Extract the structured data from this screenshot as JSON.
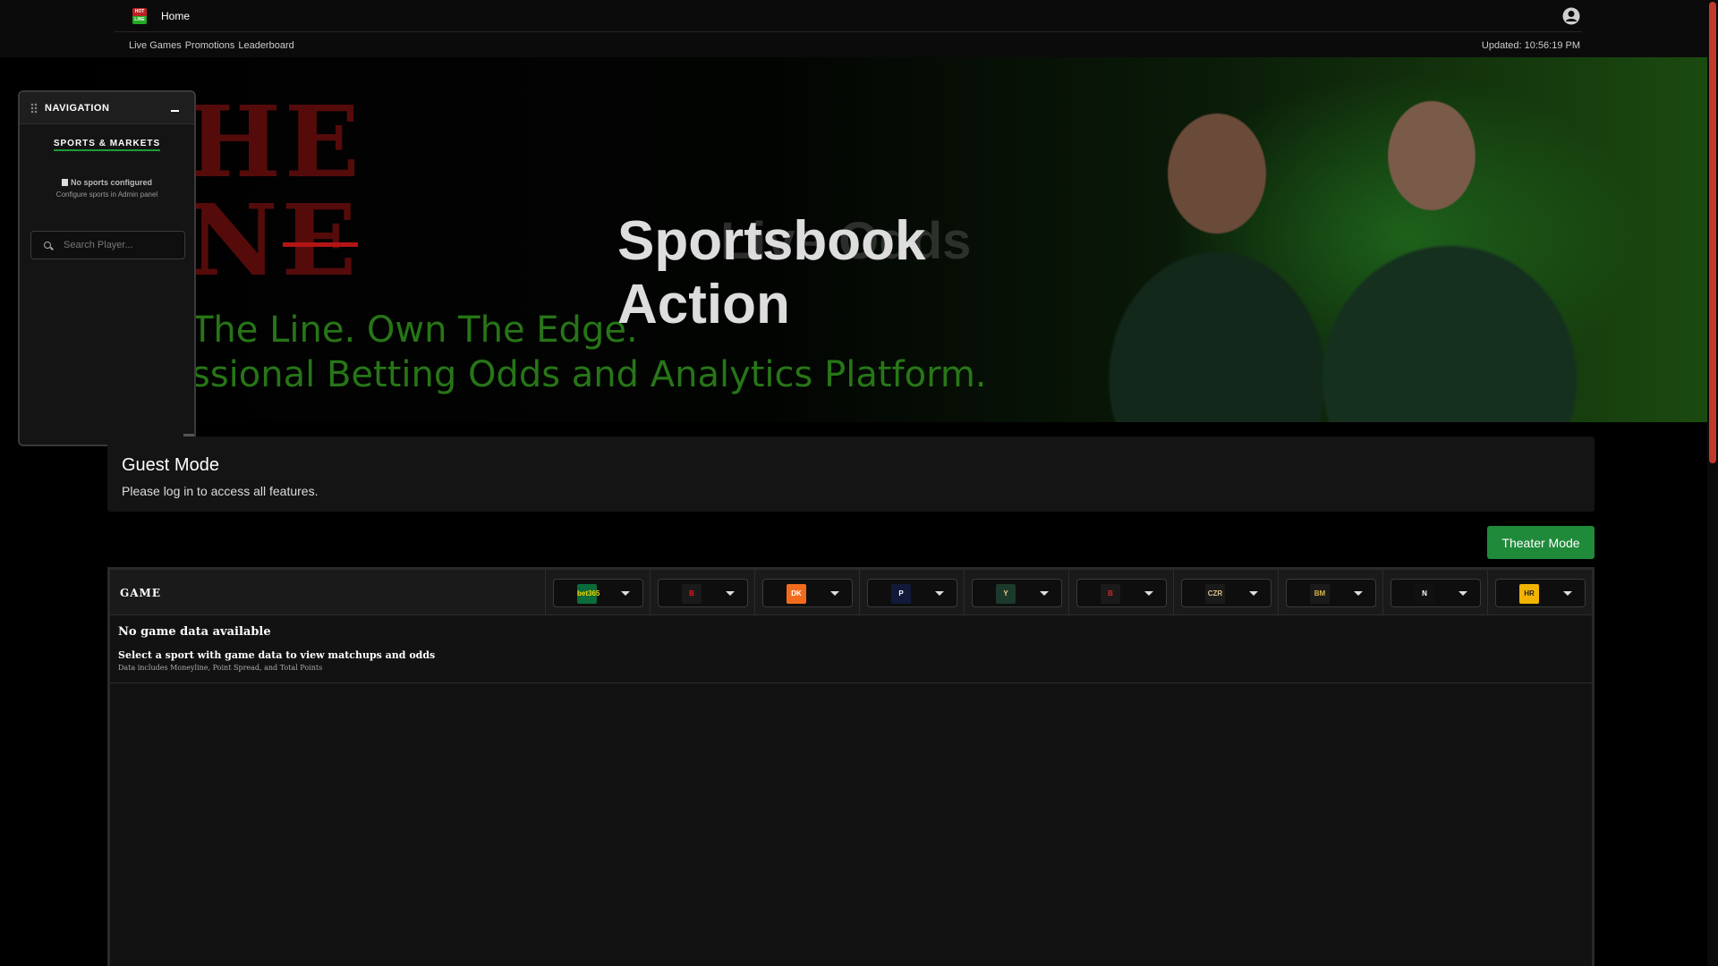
{
  "header": {
    "home_label": "Home",
    "subnav": [
      "Live Games",
      "Promotions",
      "Leaderboard"
    ],
    "updated": "Updated: 10:56:19 PM",
    "user_icon": "user-circle-icon"
  },
  "hero": {
    "title": "Sportsbook Action",
    "ghost_text": "Live Odds",
    "tagline_1": "The Line. Own The Edge.",
    "tagline_2": "ssional Betting Odds and Analytics Platform."
  },
  "navigation": {
    "title": "NAVIGATION",
    "section": "SPORTS & MARKETS",
    "empty": "No sports configured",
    "hint": "Configure sports in Admin panel",
    "search_placeholder": "Search Player..."
  },
  "guest": {
    "title": "Guest Mode",
    "message": "Please log in to access all features."
  },
  "theater_label": "Theater Mode",
  "table": {
    "game_header": "GAME",
    "books": [
      {
        "logo_text": "bet365",
        "bg": "#0b6b3a",
        "fg": "#f3d600"
      },
      {
        "logo_text": "B",
        "bg": "#1a1a1a",
        "fg": "#e02020"
      },
      {
        "logo_text": "DK",
        "bg": "#f26b1d",
        "fg": "#ffffff"
      },
      {
        "logo_text": "P",
        "bg": "#111a3a",
        "fg": "#ffffff"
      },
      {
        "logo_text": "Y",
        "bg": "#1c3a2c",
        "fg": "#e8d28a"
      },
      {
        "logo_text": "B",
        "bg": "#1a1a1a",
        "fg": "#e02020"
      },
      {
        "logo_text": "CZR",
        "bg": "#1a1a1a",
        "fg": "#d8c18a"
      },
      {
        "logo_text": "BM",
        "bg": "#1a1a1a",
        "fg": "#d8b94a"
      },
      {
        "logo_text": "N",
        "bg": "#111111",
        "fg": "#ffffff"
      },
      {
        "logo_text": "HR",
        "bg": "#f2b400",
        "fg": "#222222"
      }
    ],
    "empty_title": "No game data available",
    "empty_sub": "Select a sport with game data to view matchups and odds",
    "empty_detail": "Data includes Moneyline, Point Spread, and Total Points"
  }
}
